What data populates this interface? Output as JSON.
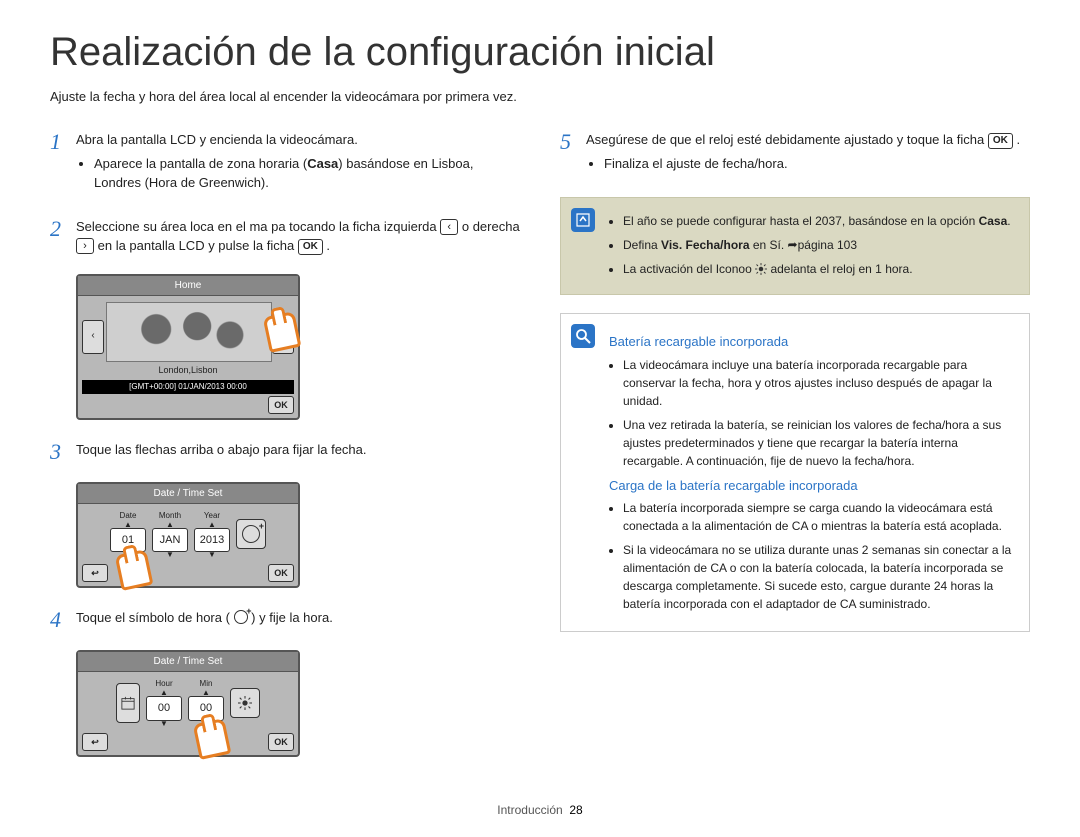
{
  "title": "Realización de la configuración inicial",
  "intro": "Ajuste la fecha y hora del área local al encender la videocámara por primera vez.",
  "ui": {
    "ok": "OK",
    "left": "‹",
    "right": "›",
    "back": "↩"
  },
  "steps": {
    "s1": {
      "num": "1",
      "text": "Abra la pantalla LCD y encienda la videocámara.",
      "bullet": "Aparece la pantalla de zona horaria (",
      "bullet_b": "Casa",
      "bullet_c": ") basándose en Lisboa, Londres (Hora de Greenwich)."
    },
    "s2": {
      "num": "2",
      "t1": "Seleccione su área loca en el ma pa tocando la ficha izquierda ",
      "t2": " o derecha ",
      "t3": " en la pantalla LCD y pulse la ficha "
    },
    "s3": {
      "num": "3",
      "text": "Toque las flechas arriba o abajo para fijar la fecha."
    },
    "s4": {
      "num": "4",
      "t1": "Toque el símbolo de hora ( ",
      "t2": " ) y fije la hora."
    },
    "s5": {
      "num": "5",
      "t1": "Asegúrese de que el reloj esté debidamente ajustado y toque la ficha ",
      "bullet": "Finaliza el ajuste de fecha/hora."
    }
  },
  "lcd_home": {
    "title": "Home",
    "city": "London,Lisbon",
    "bar": "[GMT+00:00] 01/JAN/2013 00:00"
  },
  "lcd_date": {
    "title": "Date / Time Set",
    "labels": {
      "date": "Date",
      "month": "Month",
      "year": "Year"
    },
    "vals": {
      "date": "01",
      "month": "JAN",
      "year": "2013"
    }
  },
  "lcd_time": {
    "title": "Date / Time Set",
    "labels": {
      "hour": "Hour",
      "min": "Min"
    },
    "vals": {
      "hour": "00",
      "min": "00"
    }
  },
  "note": {
    "b1a": "El año se puede configurar hasta el 2037, basándose en la opción ",
    "b1b": "Casa",
    "b1c": ".",
    "b2a": "Defina ",
    "b2b": "Vis. Fecha/hora",
    "b2c": " en Sí. ",
    "b2d": "página 103",
    "b3a": "La activación del Iconoo ",
    "b3b": " adelanta el reloj en 1 hora."
  },
  "info": {
    "h1": "Batería recargable incorporada",
    "b1": "La videocámara incluye una batería incorporada recargable para conservar la fecha, hora y otros ajustes incluso después de apagar la unidad.",
    "b2": "Una vez retirada la batería, se reinician los valores de fecha/hora a sus ajustes predeterminados y tiene que recargar la batería interna recargable. A continuación, fije de nuevo la fecha/hora.",
    "h2": "Carga de la batería recargable incorporada",
    "b3": "La batería incorporada siempre se carga cuando la videocámara está conectada a la alimentación de CA o mientras la batería está acoplada.",
    "b4": "Si la videocámara no se utiliza durante unas 2 semanas sin conectar a la alimentación de CA o con la batería colocada, la batería incorporada se descarga completamente. Si sucede esto, cargue durante 24 horas la batería incorporada con el adaptador de CA suministrado."
  },
  "footer": {
    "section": "Introducción",
    "page": "28"
  }
}
